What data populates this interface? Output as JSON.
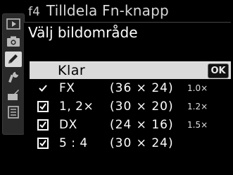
{
  "header": {
    "menu_code": "f4",
    "title": "Tilldela Fn-knapp"
  },
  "submenu": {
    "title": "Välj bildområde"
  },
  "confirm": {
    "label": "Klar",
    "badge": "OK"
  },
  "options": [
    {
      "label": "FX",
      "dims": "(36 × 24)",
      "crop": "1.0×",
      "state": "tick"
    },
    {
      "label": "1, 2×",
      "dims": "(30 × 20)",
      "crop": "1.2×",
      "state": "checked"
    },
    {
      "label": "DX",
      "dims": "(24 × 16)",
      "crop": "1.5×",
      "state": "checked"
    },
    {
      "label": "5 : 4",
      "dims": "(30 × 24)",
      "crop": "",
      "state": "checked"
    }
  ],
  "sidebar": {
    "tabs": [
      {
        "icon": "playback-icon"
      },
      {
        "icon": "camera-icon"
      },
      {
        "icon": "pencil-icon",
        "active": true
      },
      {
        "icon": "wrench-icon"
      },
      {
        "icon": "retouch-icon"
      },
      {
        "icon": "recent-settings-icon"
      }
    ]
  }
}
